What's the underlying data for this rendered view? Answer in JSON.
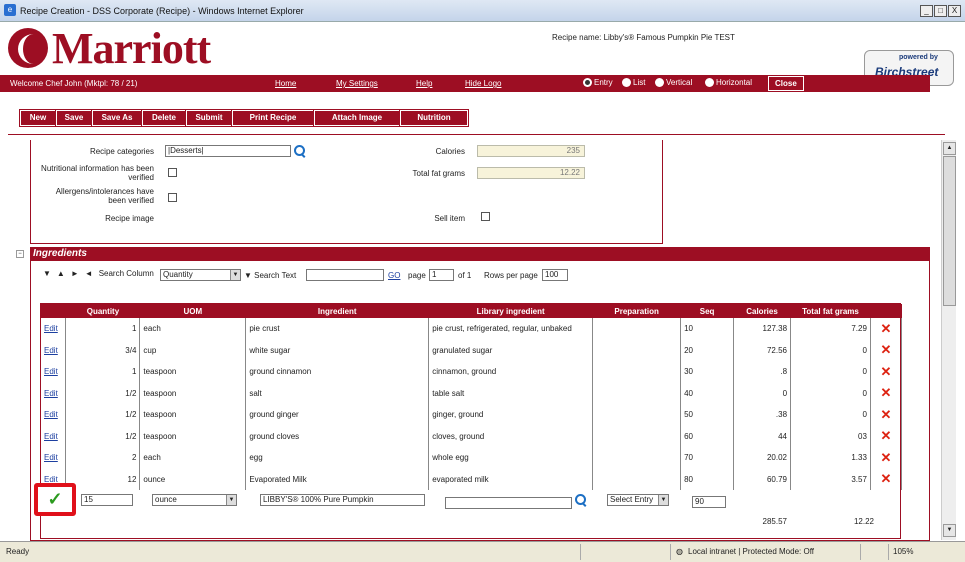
{
  "window": {
    "title": "Recipe Creation - DSS Corporate (Recipe) - Windows Internet Explorer",
    "buttons": [
      "_",
      "□",
      "X"
    ]
  },
  "header": {
    "logo_text": "Marriott",
    "recipe_name": "Recipe name: Libby's® Famous Pumpkin Pie TEST",
    "birch_powered": "powered by",
    "birch_name": "Birchstreet"
  },
  "navbar": {
    "welcome": "Welcome Chef John (Mktpl: 78 / 21)",
    "links": {
      "home": "Home",
      "settings": "My Settings",
      "help": "Help",
      "hide_logo": "Hide Logo"
    },
    "view_options": {
      "entry": "Entry",
      "list": "List",
      "vertical": "Vertical",
      "horizontal": "Horizontal"
    },
    "close": "Close"
  },
  "toolbar": {
    "new": "New",
    "save": "Save",
    "save_as": "Save As",
    "delete": "Delete",
    "submit": "Submit",
    "print": "Print Recipe",
    "attach": "Attach Image",
    "nutrition": "Nutrition"
  },
  "form": {
    "recipe_categories_label": "Recipe categories",
    "recipe_categories_value": "|Desserts|",
    "nutrition_verified_label_1": "Nutritional information has been",
    "nutrition_verified_label_2": "verified",
    "allergens_label_1": "Allergens/intolerances have",
    "allergens_label_2": "been verified",
    "recipe_image_label": "Recipe image",
    "calories_label": "Calories",
    "calories_value": "235",
    "fat_label": "Total fat grams",
    "fat_value": "12.22",
    "sell_item_label": "Sell item"
  },
  "ingredients": {
    "section_title": "Ingredients",
    "search_column_label": "Search Column",
    "search_column_value": "Quantity",
    "search_text_label": "Search Text",
    "search_text_value": "",
    "go": "GO",
    "page_label": "page",
    "page_value": "1",
    "of_label": "of 1",
    "rows_label": "Rows per page",
    "rows_value": "100",
    "columns": [
      "",
      "Quantity",
      "UOM",
      "Ingredient",
      "Library ingredient",
      "Preparation",
      "Seq",
      "Calories",
      "Total fat grams",
      ""
    ],
    "edit_label": "Edit",
    "rows": [
      {
        "qty": "1",
        "uom": "each",
        "ingredient": "pie crust",
        "library": "pie crust, refrigerated, regular, unbaked",
        "prep": "",
        "seq": "10",
        "cal": "127.38",
        "fat": "7.29"
      },
      {
        "qty": "3/4",
        "uom": "cup",
        "ingredient": "white sugar",
        "library": "granulated sugar",
        "prep": "",
        "seq": "20",
        "cal": "72.56",
        "fat": "0"
      },
      {
        "qty": "1",
        "uom": "teaspoon",
        "ingredient": "ground cinnamon",
        "library": "cinnamon, ground",
        "prep": "",
        "seq": "30",
        "cal": ".8",
        "fat": "0"
      },
      {
        "qty": "1/2",
        "uom": "teaspoon",
        "ingredient": "salt",
        "library": "table salt",
        "prep": "",
        "seq": "40",
        "cal": "0",
        "fat": "0"
      },
      {
        "qty": "1/2",
        "uom": "teaspoon",
        "ingredient": "ground ginger",
        "library": "ginger, ground",
        "prep": "",
        "seq": "50",
        "cal": ".38",
        "fat": "0"
      },
      {
        "qty": "1/2",
        "uom": "teaspoon",
        "ingredient": "ground cloves",
        "library": "cloves, ground",
        "prep": "",
        "seq": "60",
        "cal": "44",
        "fat": "03"
      },
      {
        "qty": "2",
        "uom": "each",
        "ingredient": "egg",
        "library": "whole egg",
        "prep": "",
        "seq": "70",
        "cal": "20.02",
        "fat": "1.33"
      },
      {
        "qty": "12",
        "uom": "ounce",
        "ingredient": "Evaporated Milk",
        "library": "evaporated milk",
        "prep": "",
        "seq": "80",
        "cal": "60.79",
        "fat": "3.57"
      }
    ],
    "new_row": {
      "qty": "15",
      "uom": "ounce",
      "ingredient": "LIBBY'S® 100% Pure Pumpkin",
      "library": "",
      "prep": "Select Entry",
      "seq": "90"
    },
    "totals": {
      "cal": "285.57",
      "fat": "12.22"
    }
  },
  "statusbar": {
    "ready": "Ready",
    "zone": "Local intranet | Protected Mode: Off",
    "zoom": "105%"
  },
  "colors": {
    "brand": "#9d0e23",
    "check": "#2b9a1e",
    "delete": "#dd2211"
  }
}
